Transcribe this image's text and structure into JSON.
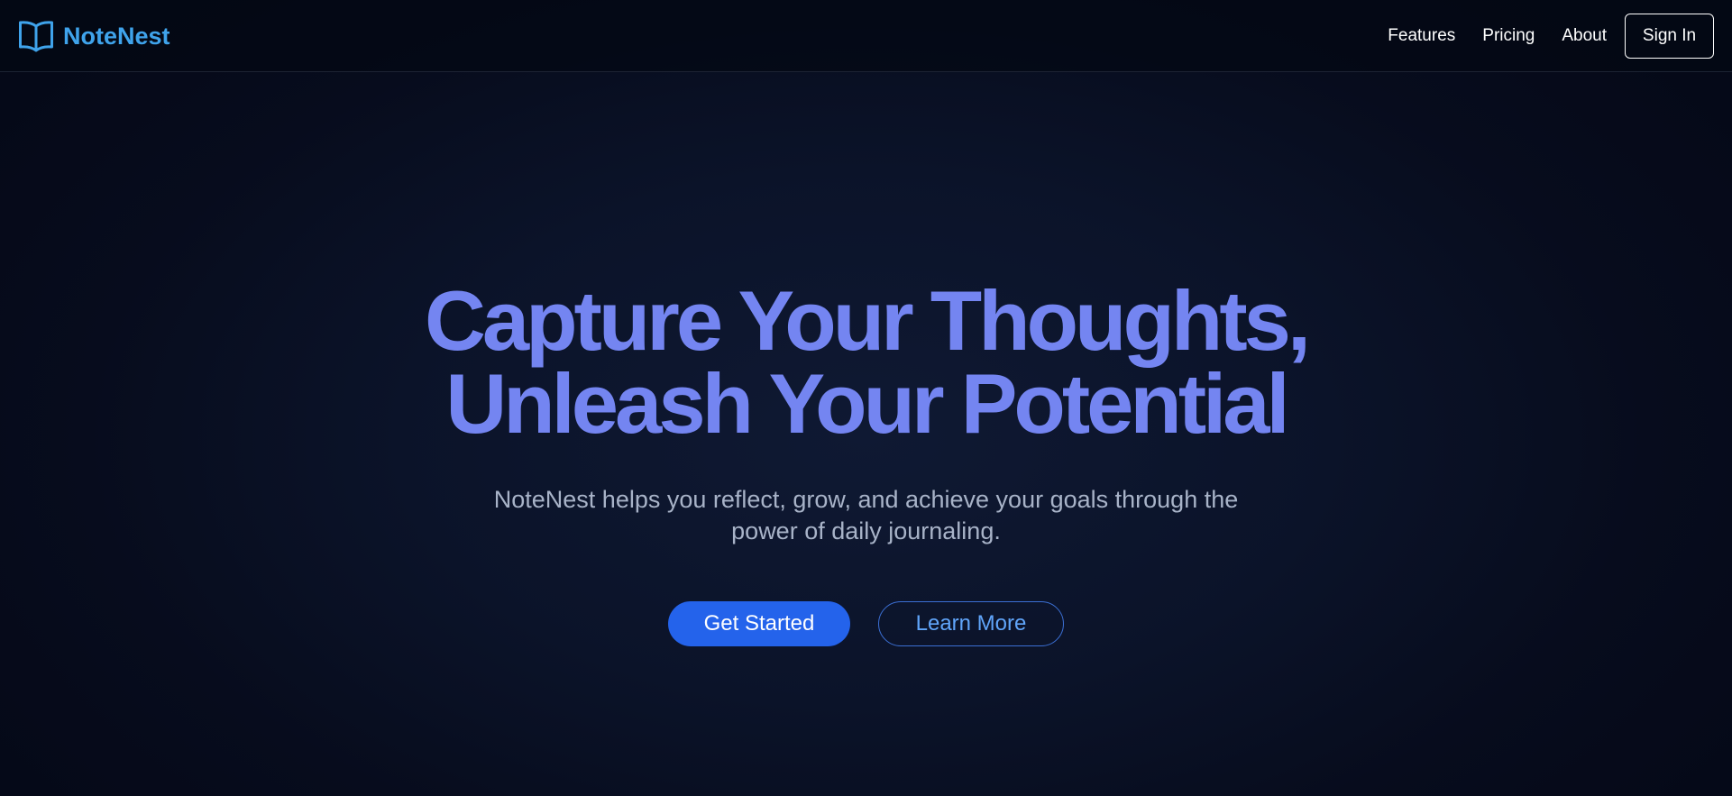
{
  "brand": {
    "icon": "open-book-icon",
    "name": "NoteNest",
    "color": "#3fa3eb"
  },
  "nav": {
    "links": [
      "Features",
      "Pricing",
      "About"
    ],
    "signin_label": "Sign In"
  },
  "hero": {
    "headline_line1": "Capture Your Thoughts,",
    "headline_line2": "Unleash Your Potential",
    "headline_color": "#7485f1",
    "tagline": "NoteNest helps you reflect, grow, and achieve your goals through the power of daily journaling.",
    "primary_label": "Get Started",
    "secondary_label": "Learn More",
    "primary_color": "#2463eb",
    "secondary_color": "#60a5fa"
  }
}
